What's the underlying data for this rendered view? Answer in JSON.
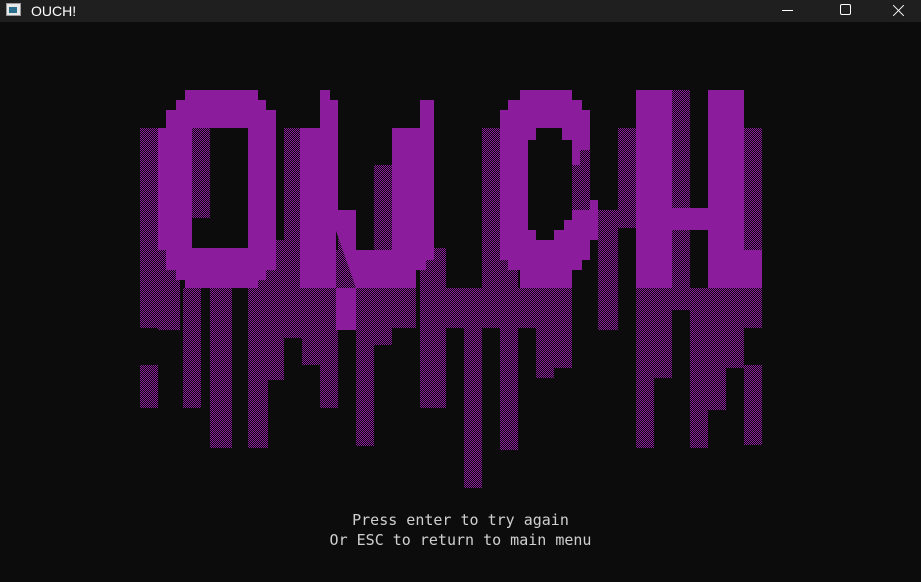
{
  "window": {
    "title": "OUCH!",
    "icon": "console-app-icon",
    "controls": [
      "minimize-icon",
      "maximize-icon",
      "close-icon"
    ]
  },
  "game_over": {
    "art_text": "OUCH",
    "prompt_line_1": "Press enter to try again",
    "prompt_line_2": "Or ESC to return to main menu"
  },
  "colors": {
    "background": "#0c0c0c",
    "titlebar": "#1f1f1f",
    "art": "#8b1c9c",
    "prompt_text": "#d0d0d0"
  }
}
